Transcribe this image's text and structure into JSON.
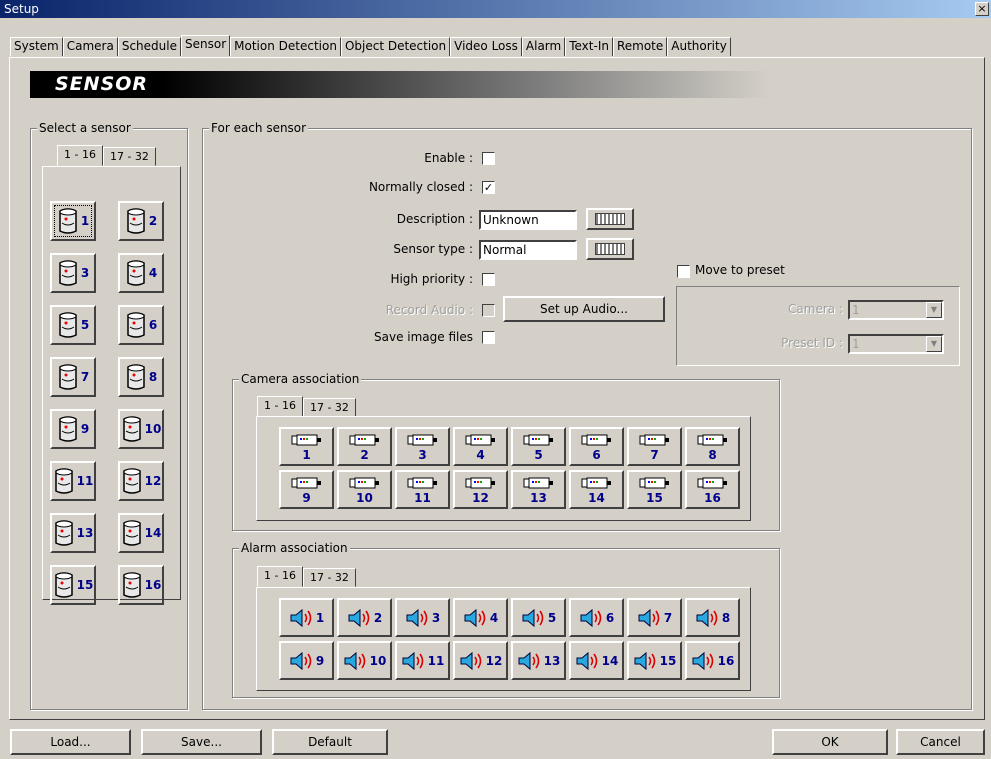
{
  "window": {
    "title": "Setup",
    "close": "×"
  },
  "tabs": [
    "System",
    "Camera",
    "Schedule",
    "Sensor",
    "Motion Detection",
    "Object Detection",
    "Video Loss",
    "Alarm",
    "Text-In",
    "Remote",
    "Authority"
  ],
  "active_tab": "Sensor",
  "banner": "SENSOR",
  "select_sensor": {
    "legend": "Select a sensor",
    "tabs": [
      "1 - 16",
      "17 - 32"
    ],
    "sensors": [
      "1",
      "2",
      "3",
      "4",
      "5",
      "6",
      "7",
      "8",
      "9",
      "10",
      "11",
      "12",
      "13",
      "14",
      "15",
      "16"
    ]
  },
  "for_each": {
    "legend": "For each sensor",
    "enable": {
      "label": "Enable :",
      "checked": ""
    },
    "normally_closed": {
      "label": "Normally closed :",
      "checked": "✓"
    },
    "description": {
      "label": "Description :",
      "value": "Unknown"
    },
    "sensor_type": {
      "label": "Sensor type :",
      "value": "Normal"
    },
    "high_priority": {
      "label": "High priority :",
      "checked": ""
    },
    "record_audio": {
      "label": "Record Audio :",
      "checked": ""
    },
    "setup_audio": "Set up Audio...",
    "save_images": {
      "label": "Save image files",
      "checked": ""
    },
    "move_preset": {
      "label": "Move to preset",
      "camera_label": "Camera :",
      "camera_value": "1",
      "preset_label": "Preset ID :",
      "preset_value": "1"
    }
  },
  "camera_assoc": {
    "legend": "Camera association",
    "tabs": [
      "1 - 16",
      "17 - 32"
    ],
    "items": [
      "1",
      "2",
      "3",
      "4",
      "5",
      "6",
      "7",
      "8",
      "9",
      "10",
      "11",
      "12",
      "13",
      "14",
      "15",
      "16"
    ]
  },
  "alarm_assoc": {
    "legend": "Alarm association",
    "tabs": [
      "1 - 16",
      "17 - 32"
    ],
    "items": [
      "1",
      "2",
      "3",
      "4",
      "5",
      "6",
      "7",
      "8",
      "9",
      "10",
      "11",
      "12",
      "13",
      "14",
      "15",
      "16"
    ]
  },
  "footer": {
    "load": "Load...",
    "save": "Save...",
    "default": "Default",
    "ok": "OK",
    "cancel": "Cancel"
  },
  "colors": {
    "title_start": "#0a246a",
    "title_end": "#a6caf0",
    "face": "#d4d0c8",
    "number": "#00008b"
  }
}
